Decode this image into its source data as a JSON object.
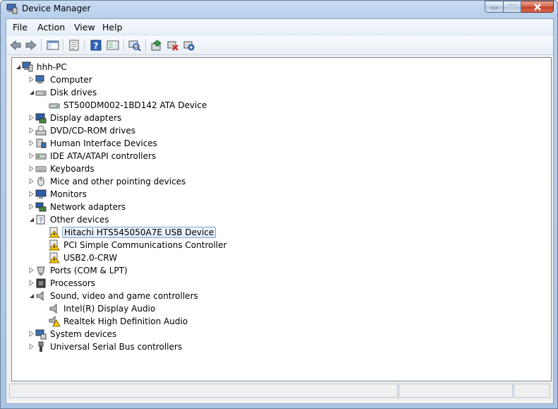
{
  "window": {
    "title": "Device Manager"
  },
  "menu": [
    "File",
    "Action",
    "View",
    "Help"
  ],
  "toolbar_icons": [
    "back-arrow-icon",
    "forward-arrow-icon",
    "show-hide-console-tree-icon",
    "properties-icon",
    "help-icon",
    "action-pane-icon",
    "scan-hardware-changes-icon",
    "update-driver-icon",
    "uninstall-device-icon",
    "enable-device-icon"
  ],
  "tree": {
    "root": "hhh-PC",
    "items": [
      {
        "label": "Computer",
        "level": 1,
        "expanded": false,
        "icon": "computer-icon"
      },
      {
        "label": "Disk drives",
        "level": 1,
        "expanded": true,
        "icon": "disk-drive-icon"
      },
      {
        "label": "ST500DM002-1BD142 ATA Device",
        "level": 2,
        "icon": "disk-drive-icon"
      },
      {
        "label": "Display adapters",
        "level": 1,
        "expanded": false,
        "icon": "display-adapter-icon"
      },
      {
        "label": "DVD/CD-ROM drives",
        "level": 1,
        "expanded": false,
        "icon": "dvd-drive-icon"
      },
      {
        "label": "Human Interface Devices",
        "level": 1,
        "expanded": false,
        "icon": "hid-icon"
      },
      {
        "label": "IDE ATA/ATAPI controllers",
        "level": 1,
        "expanded": false,
        "icon": "ide-controller-icon"
      },
      {
        "label": "Keyboards",
        "level": 1,
        "expanded": false,
        "icon": "keyboard-icon"
      },
      {
        "label": "Mice and other pointing devices",
        "level": 1,
        "expanded": false,
        "icon": "mouse-icon"
      },
      {
        "label": "Monitors",
        "level": 1,
        "expanded": false,
        "icon": "monitor-icon"
      },
      {
        "label": "Network adapters",
        "level": 1,
        "expanded": false,
        "icon": "network-adapter-icon"
      },
      {
        "label": "Other devices",
        "level": 1,
        "expanded": true,
        "icon": "unknown-device-icon"
      },
      {
        "label": "Hitachi HTS545050A7E USB Device",
        "level": 2,
        "icon": "warning-device-icon",
        "selected": true
      },
      {
        "label": "PCI Simple Communications Controller",
        "level": 2,
        "icon": "warning-device-icon"
      },
      {
        "label": "USB2.0-CRW",
        "level": 2,
        "icon": "warning-device-icon"
      },
      {
        "label": "Ports (COM & LPT)",
        "level": 1,
        "expanded": false,
        "icon": "port-icon"
      },
      {
        "label": "Processors",
        "level": 1,
        "expanded": false,
        "icon": "processor-icon"
      },
      {
        "label": "Sound, video and game controllers",
        "level": 1,
        "expanded": true,
        "icon": "speaker-icon"
      },
      {
        "label": "Intel(R) Display Audio",
        "level": 2,
        "icon": "speaker-icon"
      },
      {
        "label": "Realtek High Definition Audio",
        "level": 2,
        "icon": "speaker-warning-icon"
      },
      {
        "label": "System devices",
        "level": 1,
        "expanded": false,
        "icon": "system-device-icon"
      },
      {
        "label": "Universal Serial Bus controllers",
        "level": 1,
        "expanded": false,
        "icon": "usb-icon"
      }
    ]
  }
}
